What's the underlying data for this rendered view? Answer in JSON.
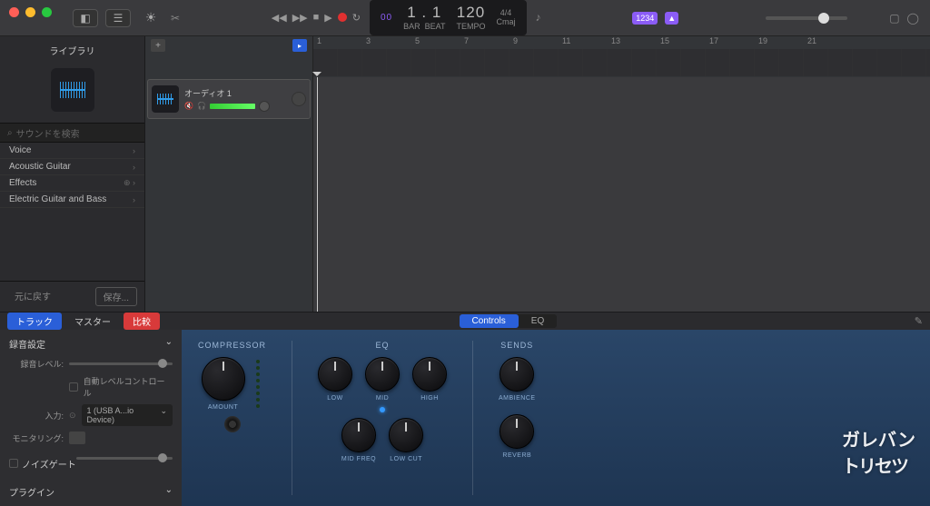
{
  "sidebar": {
    "title": "ライブラリ",
    "search_placeholder": "サウンドを検索",
    "items": [
      {
        "label": "Voice"
      },
      {
        "label": "Acoustic Guitar"
      },
      {
        "label": "Effects"
      },
      {
        "label": "Electric Guitar and Bass"
      }
    ],
    "footer": {
      "revert": "元に戻す",
      "save": "保存..."
    }
  },
  "transport": {
    "position": "1 . 1",
    "tempo": "120",
    "sig": "4/4",
    "key": "Cmaj",
    "sub1": "BAR",
    "sub2": "BEAT",
    "sub3": "TEMPO"
  },
  "badge": "1234",
  "ruler": [
    "1",
    "3",
    "5",
    "7",
    "9",
    "11",
    "13",
    "15",
    "17",
    "19",
    "21"
  ],
  "track": {
    "name": "オーディオ 1"
  },
  "bottom": {
    "tabs": {
      "track": "トラック",
      "master": "マスター",
      "compare": "比較"
    },
    "center_tabs": {
      "controls": "Controls",
      "eq": "EQ"
    },
    "inspector": {
      "header": "録音設定",
      "rec_level": "録音レベル:",
      "auto_level": "自動レベルコントロール",
      "input": "入力:",
      "input_val": "1 (USB A...io Device)",
      "monitoring": "モニタリング:",
      "noise_gate": "ノイズゲート",
      "plugin": "プラグイン"
    },
    "plugin": {
      "comp": "COMPRESSOR",
      "eq": "EQ",
      "sends": "SENDS",
      "labels": {
        "amount": "AMOUNT",
        "low": "LOW",
        "mid": "MID",
        "high": "HIGH",
        "midfreq": "MID FREQ",
        "lowcut": "LOW CUT",
        "ambience": "AMBIENCE",
        "reverb": "REVERB"
      }
    }
  },
  "watermark": {
    "l1": "ガレバン",
    "l2": "トリセツ"
  }
}
